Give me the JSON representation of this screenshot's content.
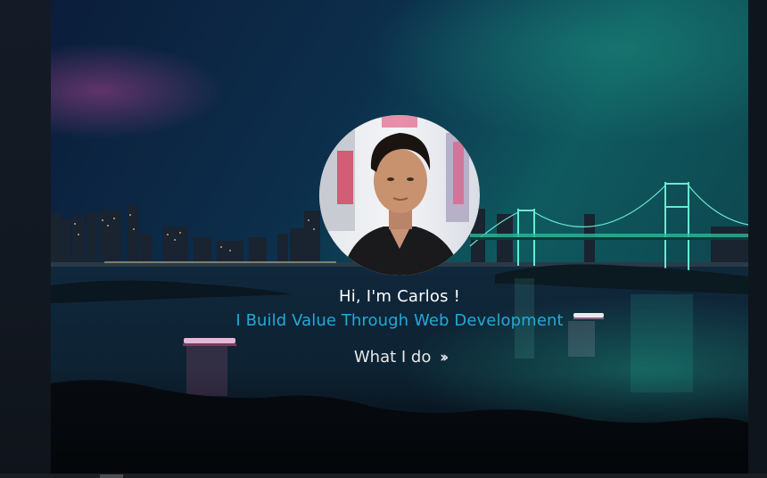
{
  "hero": {
    "greeting": "Hi, I'm Carlos !",
    "tagline": "I Build Value Through Web Development",
    "cta_label": "What I do",
    "cta_icon": "double-chevron-right-icon"
  },
  "colors": {
    "tagline": "#23a9d8",
    "greeting": "#ffffff",
    "cta": "#e6e8ea"
  }
}
